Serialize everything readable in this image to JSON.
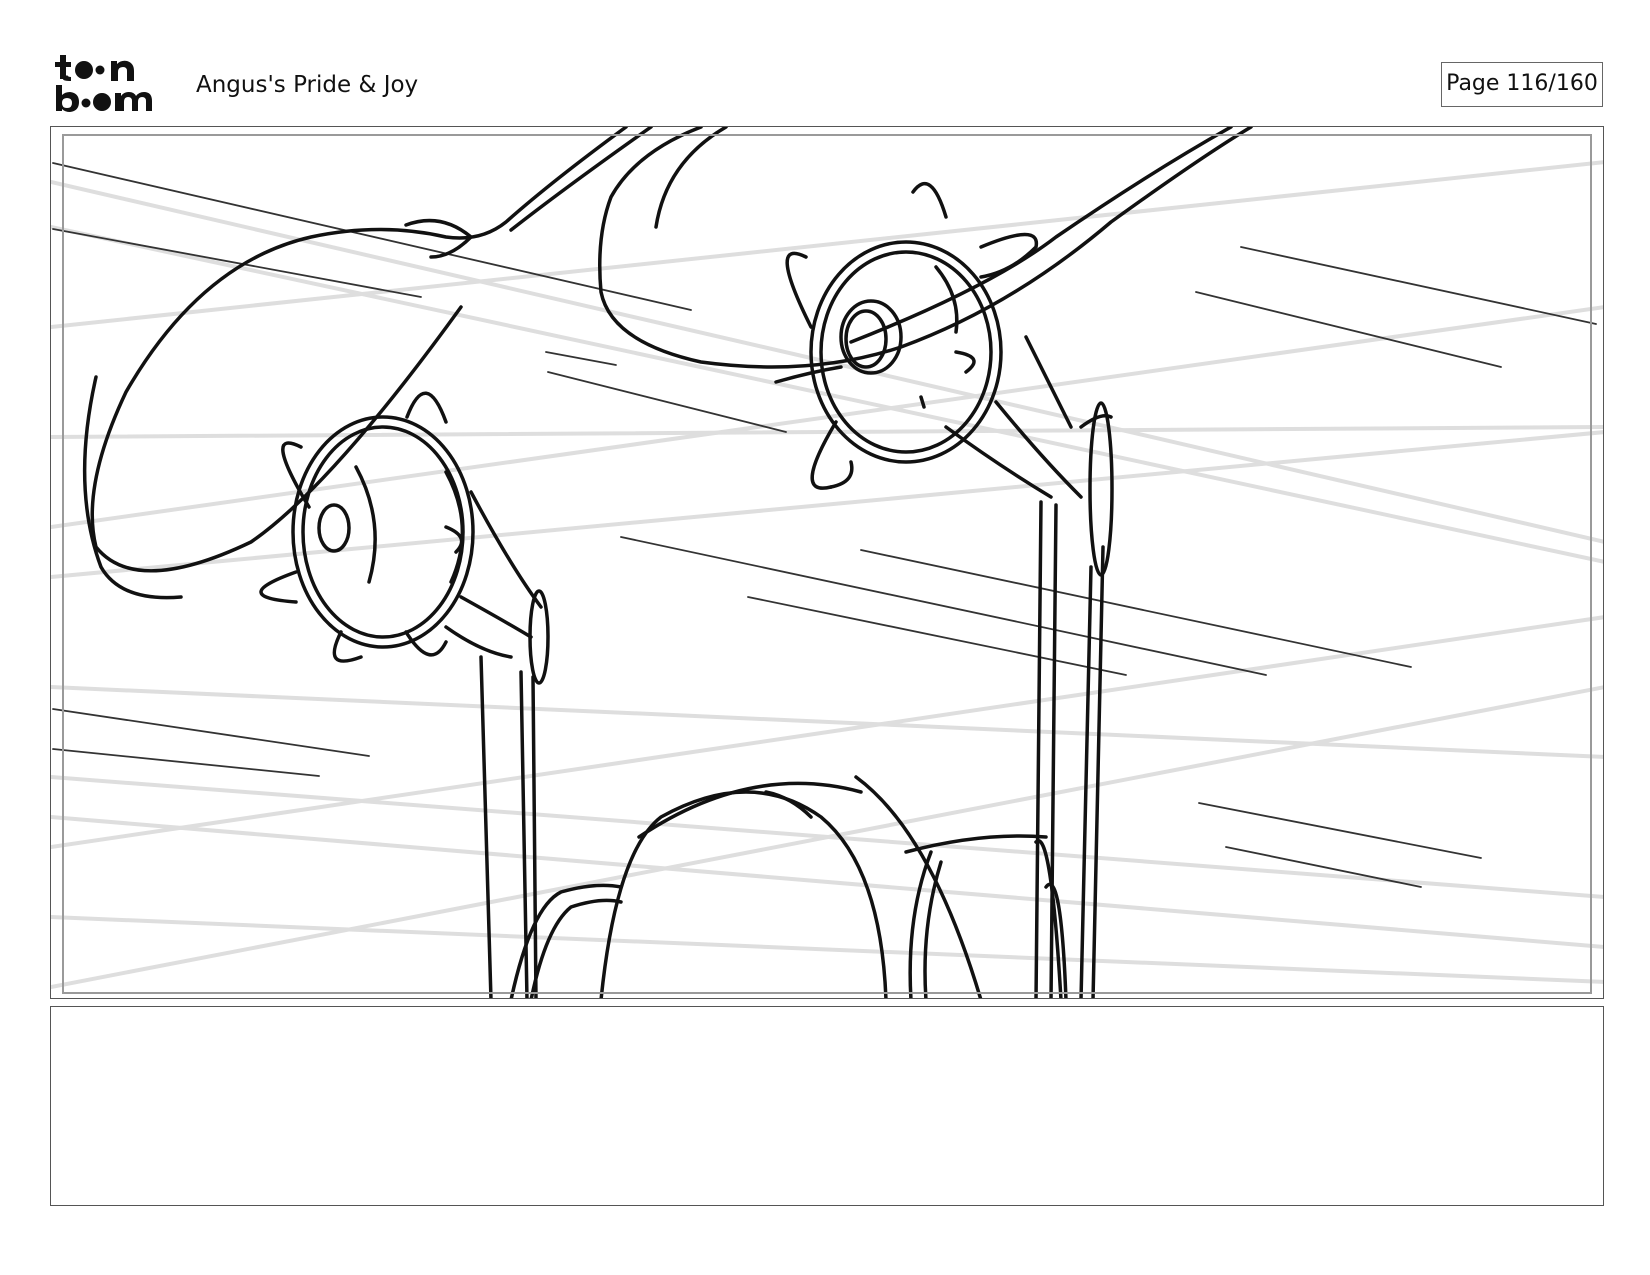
{
  "header": {
    "logo_text": "toonboom",
    "project_title": "Angus's Pride & Joy",
    "page_counter": "Page 116/160"
  },
  "panel": {
    "drawing": "storyboard sketch"
  },
  "notes": {
    "text": ""
  },
  "colors": {
    "ink": "#111111",
    "frame": "#555555",
    "safe_frame": "#9a9a9a",
    "speed_lines_light": "#dddddd"
  }
}
